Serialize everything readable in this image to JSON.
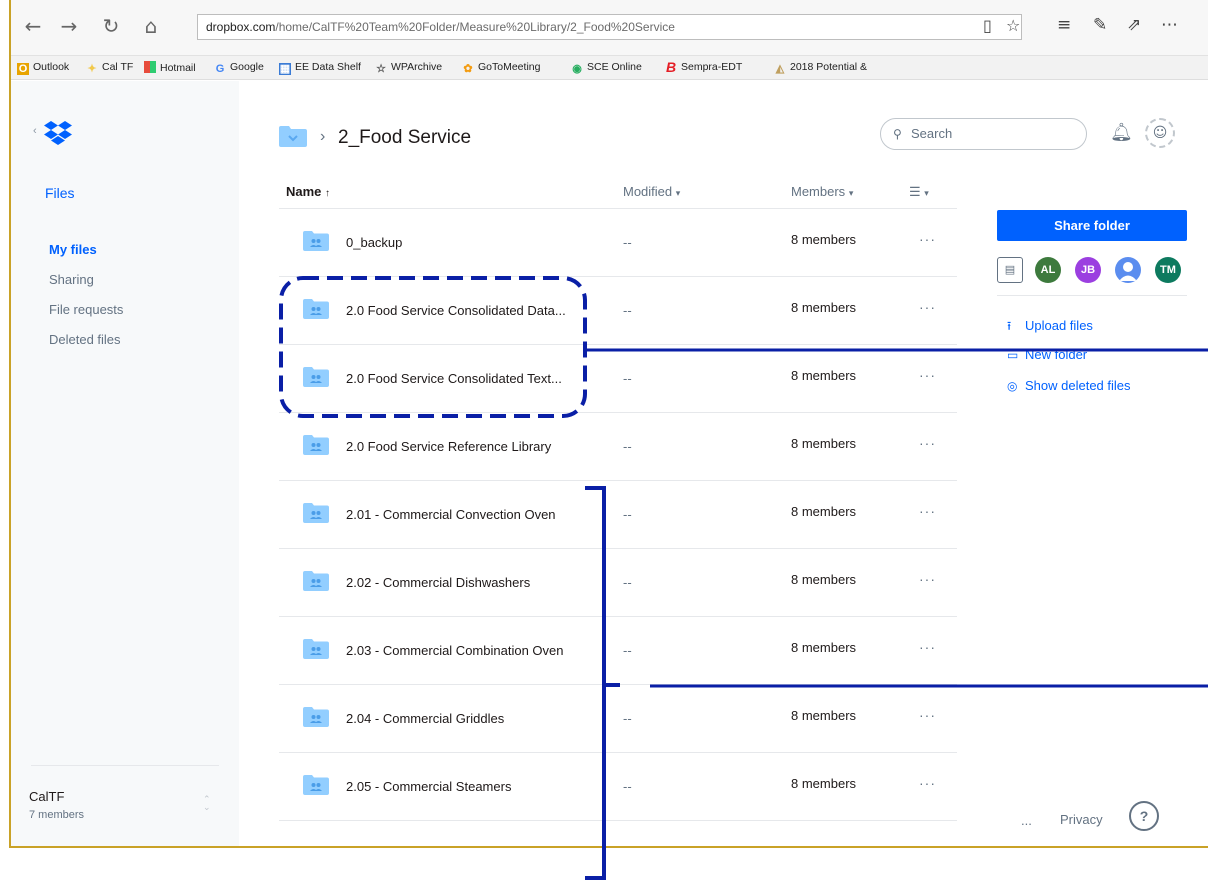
{
  "browser": {
    "url_host": "dropbox.com",
    "url_path": "/home/CalTF%20Team%20Folder/Measure%20Library/2_Food%20Service",
    "favorites": [
      {
        "label": "Outlook",
        "icon": "outlook-icon",
        "color": "#e8a400"
      },
      {
        "label": "Cal TF",
        "icon": "caltf-icon",
        "color": "#f2c94c"
      },
      {
        "label": "Hotmail",
        "icon": "windows-icon",
        "color": "#e74c3c"
      },
      {
        "label": "Google",
        "icon": "google-icon",
        "color": "#4285f4"
      },
      {
        "label": "EE Data Shelf",
        "icon": "data-shelf-icon",
        "color": "#3a7bd5"
      },
      {
        "label": "WPArchive",
        "icon": "star-icon",
        "color": "#555555"
      },
      {
        "label": "GoToMeeting",
        "icon": "gotomeeting-icon",
        "color": "#f39c12"
      },
      {
        "label": "SCE Online",
        "icon": "sce-icon",
        "color": "#27ae60"
      },
      {
        "label": "Sempra-EDT",
        "icon": "sempra-icon",
        "color": "#e41e26"
      },
      {
        "label": "2018 Potential &",
        "icon": "potential-icon",
        "color": "#c0a060"
      }
    ]
  },
  "sidebar": {
    "section": "Files",
    "items": [
      {
        "label": "My files",
        "active": true
      },
      {
        "label": "Sharing",
        "active": false
      },
      {
        "label": "File requests",
        "active": false
      },
      {
        "label": "Deleted files",
        "active": false
      }
    ],
    "team": {
      "name": "CalTF",
      "members": "7 members"
    }
  },
  "main": {
    "breadcrumb_title": "2_Food Service",
    "search_placeholder": "Search",
    "columns": {
      "name": "Name",
      "modified": "Modified",
      "members": "Members"
    },
    "rows": [
      {
        "name": "0_backup",
        "modified": "--",
        "members": "8 members"
      },
      {
        "name": "2.0 Food Service Consolidated Data...",
        "modified": "--",
        "members": "8 members"
      },
      {
        "name": "2.0 Food Service Consolidated Text...",
        "modified": "--",
        "members": "8 members"
      },
      {
        "name": "2.0 Food Service Reference Library",
        "modified": "--",
        "members": "8 members"
      },
      {
        "name": "2.01 - Commercial Convection Oven",
        "modified": "--",
        "members": "8 members"
      },
      {
        "name": "2.02 - Commercial Dishwashers",
        "modified": "--",
        "members": "8 members"
      },
      {
        "name": "2.03 - Commercial Combination Oven",
        "modified": "--",
        "members": "8 members"
      },
      {
        "name": "2.04 - Commercial Griddles",
        "modified": "--",
        "members": "8 members"
      },
      {
        "name": "2.05 - Commercial Steamers",
        "modified": "--",
        "members": "8 members"
      }
    ]
  },
  "right_panel": {
    "share_label": "Share folder",
    "avatars": [
      {
        "initials": "AL",
        "color": "#3d7a3d"
      },
      {
        "initials": "JB",
        "color": "#9b3fe0"
      },
      {
        "initials": "",
        "color": "#5b8def"
      },
      {
        "initials": "TM",
        "color": "#0d7a5f"
      }
    ],
    "actions": [
      "Upload files",
      "New folder",
      "Show deleted files"
    ],
    "footer_more": "...",
    "footer_privacy": "Privacy",
    "help": "?"
  },
  "annotation_color": "#0a1fa6"
}
